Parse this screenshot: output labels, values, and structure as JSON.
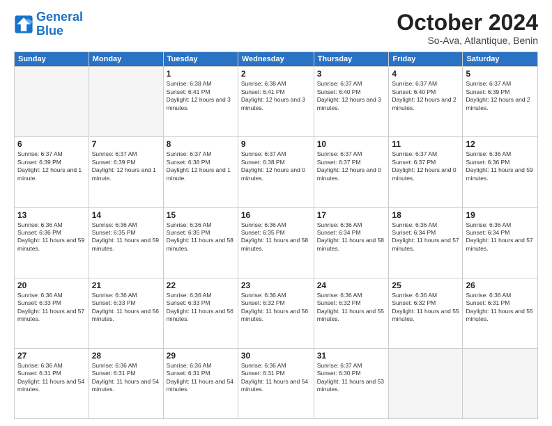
{
  "logo": {
    "line1": "General",
    "line2": "Blue"
  },
  "title": "October 2024",
  "location": "So-Ava, Atlantique, Benin",
  "days_of_week": [
    "Sunday",
    "Monday",
    "Tuesday",
    "Wednesday",
    "Thursday",
    "Friday",
    "Saturday"
  ],
  "weeks": [
    [
      {
        "day": "",
        "empty": true
      },
      {
        "day": "",
        "empty": true
      },
      {
        "day": "1",
        "sunrise": "6:38 AM",
        "sunset": "6:41 PM",
        "daylight": "12 hours and 3 minutes."
      },
      {
        "day": "2",
        "sunrise": "6:38 AM",
        "sunset": "6:41 PM",
        "daylight": "12 hours and 3 minutes."
      },
      {
        "day": "3",
        "sunrise": "6:37 AM",
        "sunset": "6:40 PM",
        "daylight": "12 hours and 3 minutes."
      },
      {
        "day": "4",
        "sunrise": "6:37 AM",
        "sunset": "6:40 PM",
        "daylight": "12 hours and 2 minutes."
      },
      {
        "day": "5",
        "sunrise": "6:37 AM",
        "sunset": "6:39 PM",
        "daylight": "12 hours and 2 minutes."
      }
    ],
    [
      {
        "day": "6",
        "sunrise": "6:37 AM",
        "sunset": "6:39 PM",
        "daylight": "12 hours and 1 minute."
      },
      {
        "day": "7",
        "sunrise": "6:37 AM",
        "sunset": "6:39 PM",
        "daylight": "12 hours and 1 minute."
      },
      {
        "day": "8",
        "sunrise": "6:37 AM",
        "sunset": "6:38 PM",
        "daylight": "12 hours and 1 minute."
      },
      {
        "day": "9",
        "sunrise": "6:37 AM",
        "sunset": "6:38 PM",
        "daylight": "12 hours and 0 minutes."
      },
      {
        "day": "10",
        "sunrise": "6:37 AM",
        "sunset": "6:37 PM",
        "daylight": "12 hours and 0 minutes."
      },
      {
        "day": "11",
        "sunrise": "6:37 AM",
        "sunset": "6:37 PM",
        "daylight": "12 hours and 0 minutes."
      },
      {
        "day": "12",
        "sunrise": "6:36 AM",
        "sunset": "6:36 PM",
        "daylight": "11 hours and 59 minutes."
      }
    ],
    [
      {
        "day": "13",
        "sunrise": "6:36 AM",
        "sunset": "6:36 PM",
        "daylight": "11 hours and 59 minutes."
      },
      {
        "day": "14",
        "sunrise": "6:36 AM",
        "sunset": "6:35 PM",
        "daylight": "11 hours and 59 minutes."
      },
      {
        "day": "15",
        "sunrise": "6:36 AM",
        "sunset": "6:35 PM",
        "daylight": "11 hours and 58 minutes."
      },
      {
        "day": "16",
        "sunrise": "6:36 AM",
        "sunset": "6:35 PM",
        "daylight": "11 hours and 58 minutes."
      },
      {
        "day": "17",
        "sunrise": "6:36 AM",
        "sunset": "6:34 PM",
        "daylight": "11 hours and 58 minutes."
      },
      {
        "day": "18",
        "sunrise": "6:36 AM",
        "sunset": "6:34 PM",
        "daylight": "11 hours and 57 minutes."
      },
      {
        "day": "19",
        "sunrise": "6:36 AM",
        "sunset": "6:34 PM",
        "daylight": "11 hours and 57 minutes."
      }
    ],
    [
      {
        "day": "20",
        "sunrise": "6:36 AM",
        "sunset": "6:33 PM",
        "daylight": "11 hours and 57 minutes."
      },
      {
        "day": "21",
        "sunrise": "6:36 AM",
        "sunset": "6:33 PM",
        "daylight": "11 hours and 56 minutes."
      },
      {
        "day": "22",
        "sunrise": "6:36 AM",
        "sunset": "6:33 PM",
        "daylight": "11 hours and 56 minutes."
      },
      {
        "day": "23",
        "sunrise": "6:36 AM",
        "sunset": "6:32 PM",
        "daylight": "11 hours and 56 minutes."
      },
      {
        "day": "24",
        "sunrise": "6:36 AM",
        "sunset": "6:32 PM",
        "daylight": "11 hours and 55 minutes."
      },
      {
        "day": "25",
        "sunrise": "6:36 AM",
        "sunset": "6:32 PM",
        "daylight": "11 hours and 55 minutes."
      },
      {
        "day": "26",
        "sunrise": "6:36 AM",
        "sunset": "6:31 PM",
        "daylight": "11 hours and 55 minutes."
      }
    ],
    [
      {
        "day": "27",
        "sunrise": "6:36 AM",
        "sunset": "6:31 PM",
        "daylight": "11 hours and 54 minutes."
      },
      {
        "day": "28",
        "sunrise": "6:36 AM",
        "sunset": "6:31 PM",
        "daylight": "11 hours and 54 minutes."
      },
      {
        "day": "29",
        "sunrise": "6:36 AM",
        "sunset": "6:31 PM",
        "daylight": "11 hours and 54 minutes."
      },
      {
        "day": "30",
        "sunrise": "6:36 AM",
        "sunset": "6:31 PM",
        "daylight": "11 hours and 54 minutes."
      },
      {
        "day": "31",
        "sunrise": "6:37 AM",
        "sunset": "6:30 PM",
        "daylight": "11 hours and 53 minutes."
      },
      {
        "day": "",
        "empty": true
      },
      {
        "day": "",
        "empty": true
      }
    ]
  ]
}
